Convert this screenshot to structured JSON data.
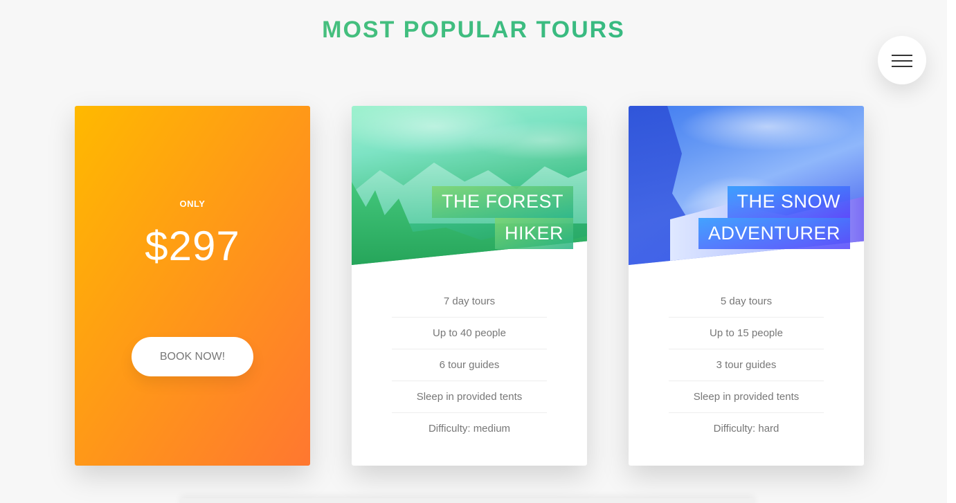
{
  "section": {
    "title": "MOST POPULAR TOURS"
  },
  "menu": {
    "icon": "hamburger-menu-icon"
  },
  "price_card": {
    "only_label": "ONLY",
    "price": "$297",
    "cta_label": "BOOK NOW!"
  },
  "tours": [
    {
      "heading_line1": "THE FOREST",
      "heading_line2": "HIKER",
      "details": [
        "7 day tours",
        "Up to 40 people",
        "6 tour guides",
        "Sleep in provided tents",
        "Difficulty: medium"
      ]
    },
    {
      "heading_line1": "THE SNOW",
      "heading_line2": "ADVENTURER",
      "details": [
        "5 day tours",
        "Up to 15 people",
        "3 tour guides",
        "Sleep in provided tents",
        "Difficulty: hard"
      ]
    }
  ],
  "colors": {
    "title_gradient_start": "#55c57a",
    "title_gradient_end": "#28b485",
    "price_card_start": "#ffb900",
    "price_card_end": "#ff7730",
    "forest_accent": "#28b485",
    "snow_accent": "#5643fa"
  }
}
